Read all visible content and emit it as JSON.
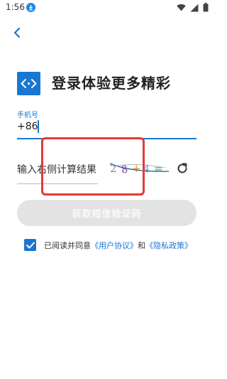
{
  "status_bar": {
    "time": "1:56",
    "icons": [
      "download-badge-icon",
      "wifi-icon",
      "signal-icon",
      "battery-icon"
    ]
  },
  "nav": {
    "back_icon": "chevron-left-icon"
  },
  "header": {
    "headline": "登录体验更多精彩",
    "logo_icon": "code-brackets-logo-icon"
  },
  "phone": {
    "label": "手机号",
    "prefix": "+86",
    "value": ""
  },
  "captcha": {
    "label": "输入右侧计算结果",
    "image_text": "2 8 + 4 =",
    "refresh_icon": "refresh-icon"
  },
  "sms_button": {
    "label": "获取短信验证码"
  },
  "agreement": {
    "checked": true,
    "prefix": "已阅读并同意",
    "user_agreement": "《用户协议》",
    "and": "和",
    "privacy_policy": "《隐私政策》"
  },
  "colors": {
    "accent": "#1976d2",
    "highlight": "#e53935",
    "disabled_button": "#e3e3e3"
  }
}
